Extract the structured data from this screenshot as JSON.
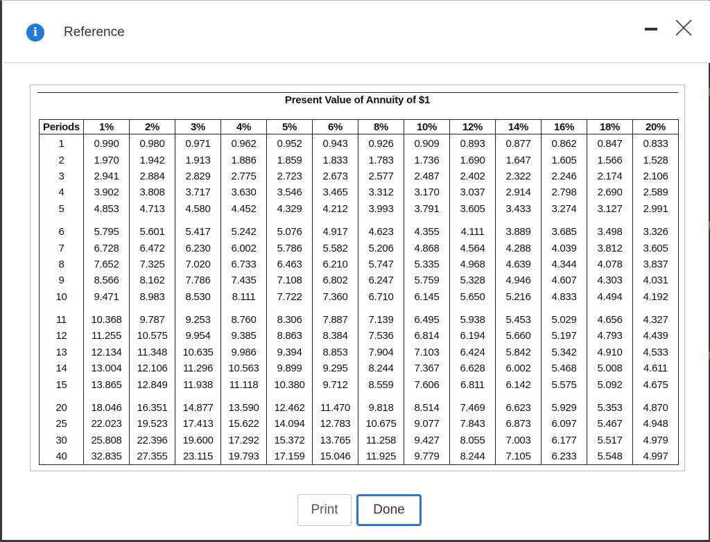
{
  "header": {
    "title": "Reference",
    "info_icon": "info-icon",
    "info_glyph": "i",
    "minimize_icon": "minimize-icon",
    "close_icon": "close-icon"
  },
  "colors": {
    "accent": "#2f76c9",
    "info": "#1f7ad8"
  },
  "table": {
    "title": "Present Value of Annuity of $1",
    "columns": [
      "Periods",
      "1%",
      "2%",
      "3%",
      "4%",
      "5%",
      "6%",
      "8%",
      "10%",
      "12%",
      "14%",
      "16%",
      "18%",
      "20%"
    ],
    "groups": [
      [
        [
          "1",
          "0.990",
          "0.980",
          "0.971",
          "0.962",
          "0.952",
          "0.943",
          "0.926",
          "0.909",
          "0.893",
          "0.877",
          "0.862",
          "0.847",
          "0.833"
        ],
        [
          "2",
          "1.970",
          "1.942",
          "1.913",
          "1.886",
          "1.859",
          "1.833",
          "1.783",
          "1.736",
          "1.690",
          "1.647",
          "1.605",
          "1.566",
          "1.528"
        ],
        [
          "3",
          "2.941",
          "2.884",
          "2.829",
          "2.775",
          "2.723",
          "2.673",
          "2.577",
          "2.487",
          "2.402",
          "2.322",
          "2.246",
          "2.174",
          "2.106"
        ],
        [
          "4",
          "3.902",
          "3.808",
          "3.717",
          "3.630",
          "3.546",
          "3.465",
          "3.312",
          "3.170",
          "3.037",
          "2.914",
          "2.798",
          "2.690",
          "2.589"
        ],
        [
          "5",
          "4.853",
          "4.713",
          "4.580",
          "4.452",
          "4.329",
          "4.212",
          "3.993",
          "3.791",
          "3.605",
          "3.433",
          "3.274",
          "3.127",
          "2.991"
        ]
      ],
      [
        [
          "6",
          "5.795",
          "5.601",
          "5.417",
          "5.242",
          "5.076",
          "4.917",
          "4.623",
          "4.355",
          "4.111",
          "3.889",
          "3.685",
          "3.498",
          "3.326"
        ],
        [
          "7",
          "6.728",
          "6.472",
          "6.230",
          "6.002",
          "5.786",
          "5.582",
          "5.206",
          "4.868",
          "4.564",
          "4.288",
          "4.039",
          "3.812",
          "3.605"
        ],
        [
          "8",
          "7.652",
          "7.325",
          "7.020",
          "6.733",
          "6.463",
          "6.210",
          "5.747",
          "5.335",
          "4.968",
          "4.639",
          "4.344",
          "4.078",
          "3.837"
        ],
        [
          "9",
          "8.566",
          "8.162",
          "7.786",
          "7.435",
          "7.108",
          "6.802",
          "6.247",
          "5.759",
          "5.328",
          "4.946",
          "4.607",
          "4.303",
          "4.031"
        ],
        [
          "10",
          "9.471",
          "8.983",
          "8.530",
          "8.111",
          "7.722",
          "7.360",
          "6.710",
          "6.145",
          "5.650",
          "5.216",
          "4.833",
          "4.494",
          "4.192"
        ]
      ],
      [
        [
          "11",
          "10.368",
          "9.787",
          "9.253",
          "8.760",
          "8.306",
          "7.887",
          "7.139",
          "6.495",
          "5.938",
          "5.453",
          "5.029",
          "4.656",
          "4.327"
        ],
        [
          "12",
          "11.255",
          "10.575",
          "9.954",
          "9.385",
          "8.863",
          "8.384",
          "7.536",
          "6.814",
          "6.194",
          "5.660",
          "5.197",
          "4.793",
          "4.439"
        ],
        [
          "13",
          "12.134",
          "11.348",
          "10.635",
          "9.986",
          "9.394",
          "8.853",
          "7.904",
          "7.103",
          "6.424",
          "5.842",
          "5.342",
          "4.910",
          "4.533"
        ],
        [
          "14",
          "13.004",
          "12.106",
          "11.296",
          "10.563",
          "9.899",
          "9.295",
          "8.244",
          "7.367",
          "6.628",
          "6.002",
          "5.468",
          "5.008",
          "4.611"
        ],
        [
          "15",
          "13.865",
          "12.849",
          "11.938",
          "11.118",
          "10.380",
          "9.712",
          "8.559",
          "7.606",
          "6.811",
          "6.142",
          "5.575",
          "5.092",
          "4.675"
        ]
      ],
      [
        [
          "20",
          "18.046",
          "16.351",
          "14.877",
          "13.590",
          "12.462",
          "11.470",
          "9.818",
          "8.514",
          "7.469",
          "6.623",
          "5.929",
          "5.353",
          "4.870"
        ],
        [
          "25",
          "22.023",
          "19.523",
          "17.413",
          "15.622",
          "14.094",
          "12.783",
          "10.675",
          "9.077",
          "7.843",
          "6.873",
          "6.097",
          "5.467",
          "4.948"
        ],
        [
          "30",
          "25.808",
          "22.396",
          "19.600",
          "17.292",
          "15.372",
          "13.765",
          "11.258",
          "9.427",
          "8.055",
          "7.003",
          "6.177",
          "5.517",
          "4.979"
        ],
        [
          "40",
          "32.835",
          "27.355",
          "23.115",
          "19.793",
          "17.159",
          "15.046",
          "11.925",
          "9.779",
          "8.244",
          "7.105",
          "6.233",
          "5.548",
          "4.997"
        ]
      ]
    ]
  },
  "buttons": {
    "print": "Print",
    "done": "Done"
  }
}
